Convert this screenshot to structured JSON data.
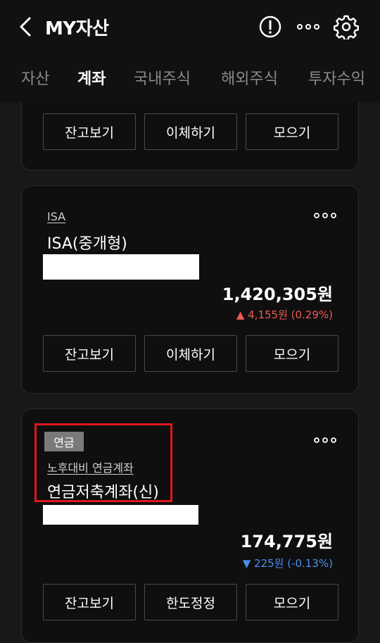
{
  "header": {
    "title": "MY자산",
    "tabs": [
      {
        "label": "자산",
        "active": false
      },
      {
        "label": "계좌",
        "active": true
      },
      {
        "label": "국내주식",
        "active": false
      },
      {
        "label": "해외주식",
        "active": false
      },
      {
        "label": "투자수익",
        "active": false
      }
    ],
    "icons": [
      "back-chevron-icon",
      "alert-circle-icon",
      "more-horizontal-icon",
      "gear-icon"
    ]
  },
  "cards": [
    {
      "buttons": [
        "잔고보기",
        "이체하기",
        "모으기"
      ]
    },
    {
      "type_link": "ISA",
      "name": "ISA(중개형)",
      "amount": "1,420,305원",
      "change": "▲ 4,155원 (0.29%)",
      "change_direction": "up",
      "buttons": [
        "잔고보기",
        "이체하기",
        "모으기"
      ]
    },
    {
      "badge": "연금",
      "type_link": "노후대비 연금계좌",
      "name": "연금저축계좌(신)",
      "amount": "174,775원",
      "change": "▼ 225원 (-0.13%)",
      "change_direction": "down",
      "buttons": [
        "잔고보기",
        "한도정정",
        "모으기"
      ]
    }
  ],
  "colors": {
    "up": "#ef5a55",
    "down": "#4c8df0",
    "highlight_border": "#e0161c",
    "badge_bg": "#7a7a7a"
  }
}
